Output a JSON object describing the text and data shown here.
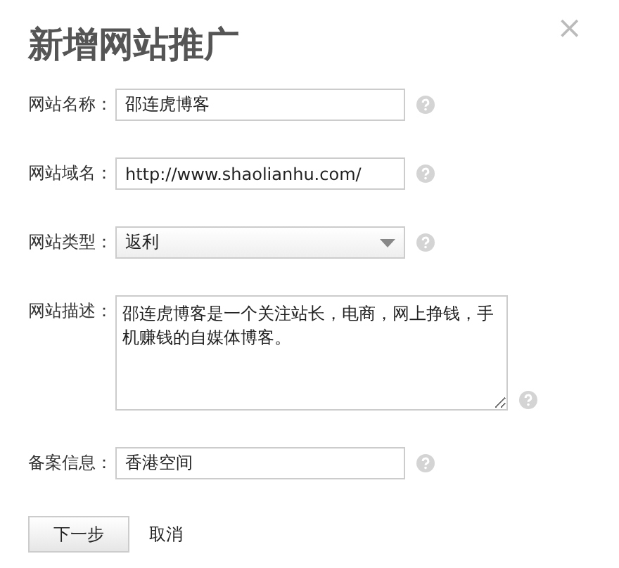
{
  "dialog": {
    "title": "新增网站推广",
    "close": "×"
  },
  "fields": [
    {
      "kind": "text",
      "label": "网站名称：",
      "value": "邵连虎博客"
    },
    {
      "kind": "text",
      "label": "网站域名：",
      "value": "http://www.shaolianhu.com/"
    },
    {
      "kind": "select",
      "label": "网站类型：",
      "value": "返利"
    },
    {
      "kind": "textarea",
      "label": "网站描述：",
      "value": "邵连虎博客是一个关注站长，电商，网上挣钱，手机赚钱的自媒体博客。"
    },
    {
      "kind": "text",
      "label": "备案信息：",
      "value": "香港空间"
    }
  ],
  "buttons": [
    {
      "kind": "primary",
      "label": "下一步"
    },
    {
      "kind": "link",
      "label": "取消"
    }
  ]
}
